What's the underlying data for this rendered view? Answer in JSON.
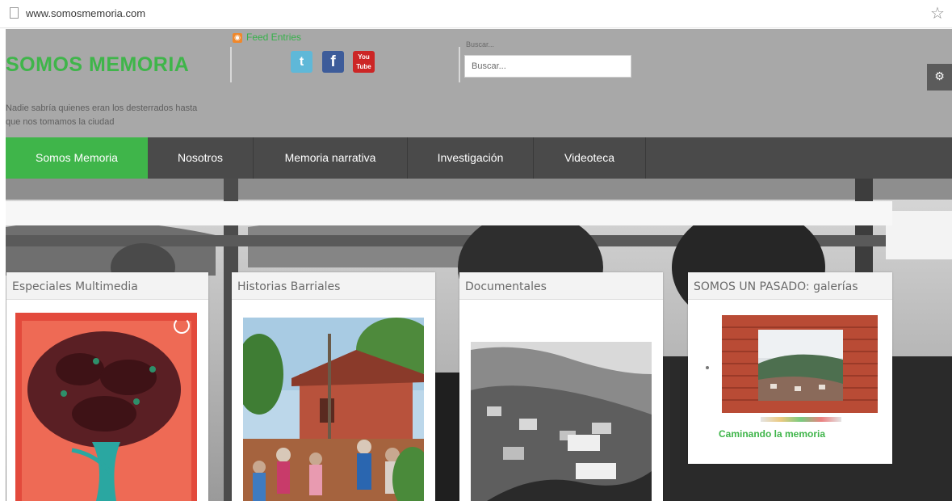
{
  "browser": {
    "url": "www.somosmemoria.com"
  },
  "header": {
    "site_title": "SOMOS MEMORIA",
    "tagline": "Nadie sabría quienes eran los desterrados hasta que nos tomamos la ciudad",
    "feed_label": "Feed Entries",
    "social": {
      "twitter_glyph": "t",
      "facebook_glyph": "f",
      "youtube_glyph": "You Tube"
    },
    "search_label": "Buscar...",
    "search_value": "Buscar..."
  },
  "nav": {
    "items": [
      {
        "label": "Somos Memoria",
        "active": true
      },
      {
        "label": "Nosotros",
        "active": false
      },
      {
        "label": "Memoria narrativa",
        "active": false
      },
      {
        "label": "Investigación",
        "active": false
      },
      {
        "label": "Videoteca",
        "active": false
      }
    ]
  },
  "cards": [
    {
      "title": "Especiales Multimedia"
    },
    {
      "title": "Historias Barriales"
    },
    {
      "title": "Documentales"
    },
    {
      "title": "SOMOS UN PASADO: galerías",
      "caption": "Caminando la memoria"
    }
  ],
  "colors": {
    "brand_green": "#3fb54a",
    "header_gray": "#a8a8a8",
    "nav_dark": "#4a4a4a"
  }
}
